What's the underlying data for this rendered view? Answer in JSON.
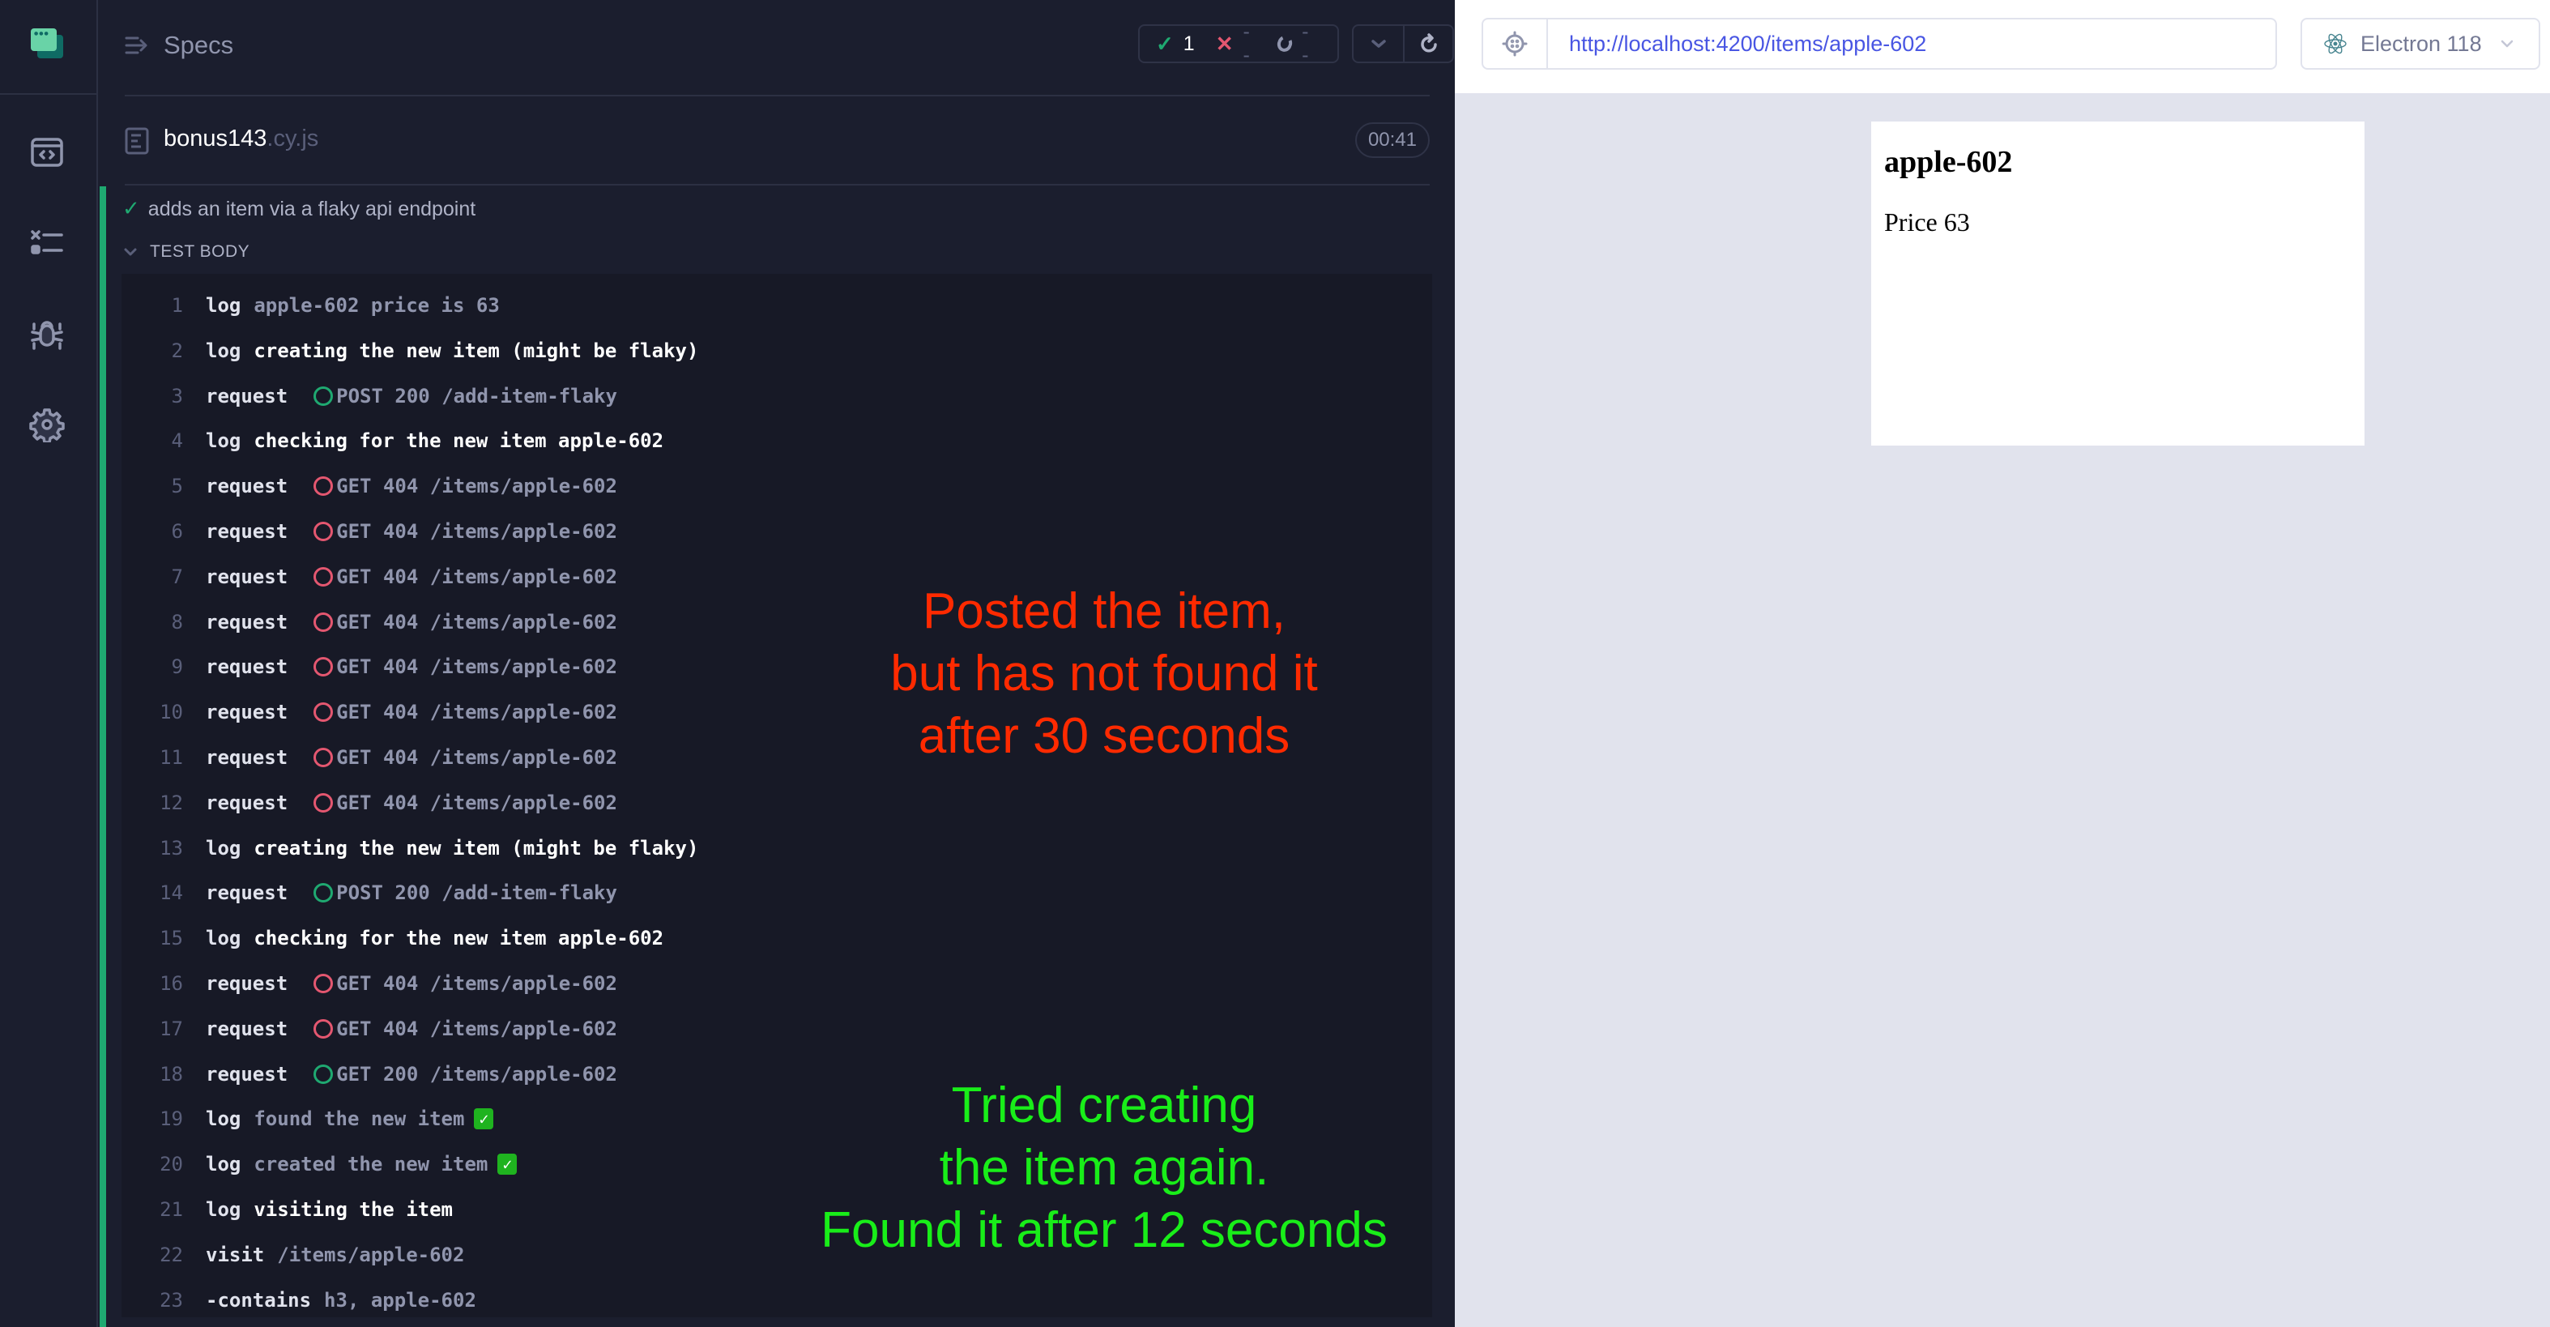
{
  "sidebar": {
    "logo": "cypress-app-logo",
    "items": [
      {
        "name": "specs",
        "icon": "code-window-icon"
      },
      {
        "name": "runs",
        "icon": "test-list-icon"
      },
      {
        "name": "debug",
        "icon": "bug-icon"
      },
      {
        "name": "settings",
        "icon": "gear-icon"
      }
    ]
  },
  "reporter": {
    "header": {
      "title": "Specs",
      "stats": {
        "passed": "1",
        "failed": "--",
        "pending": "--"
      }
    },
    "spec": {
      "name": "bonus143",
      "ext": ".cy.js",
      "duration": "00:41"
    },
    "test": {
      "title": "adds an item via a flaky api endpoint",
      "state": "passed",
      "section": "TEST BODY"
    },
    "commands": [
      {
        "n": "1",
        "cmd": "log",
        "msg": "apple-602 price is 63",
        "strong": false
      },
      {
        "n": "2",
        "cmd": "log",
        "msg": "creating the new item (might be flaky)",
        "strong": true
      },
      {
        "n": "3",
        "cmd": "request",
        "status": "ok",
        "msg": "POST 200 /add-item-flaky"
      },
      {
        "n": "4",
        "cmd": "log",
        "msg": "checking for the new item apple-602",
        "strong": true
      },
      {
        "n": "5",
        "cmd": "request",
        "status": "err",
        "msg": "GET 404 /items/apple-602"
      },
      {
        "n": "6",
        "cmd": "request",
        "status": "err",
        "msg": "GET 404 /items/apple-602"
      },
      {
        "n": "7",
        "cmd": "request",
        "status": "err",
        "msg": "GET 404 /items/apple-602"
      },
      {
        "n": "8",
        "cmd": "request",
        "status": "err",
        "msg": "GET 404 /items/apple-602"
      },
      {
        "n": "9",
        "cmd": "request",
        "status": "err",
        "msg": "GET 404 /items/apple-602"
      },
      {
        "n": "10",
        "cmd": "request",
        "status": "err",
        "msg": "GET 404 /items/apple-602"
      },
      {
        "n": "11",
        "cmd": "request",
        "status": "err",
        "msg": "GET 404 /items/apple-602"
      },
      {
        "n": "12",
        "cmd": "request",
        "status": "err",
        "msg": "GET 404 /items/apple-602"
      },
      {
        "n": "13",
        "cmd": "log",
        "msg": "creating the new item (might be flaky)",
        "strong": true
      },
      {
        "n": "14",
        "cmd": "request",
        "status": "ok",
        "msg": "POST 200 /add-item-flaky"
      },
      {
        "n": "15",
        "cmd": "log",
        "msg": "checking for the new item apple-602",
        "strong": true
      },
      {
        "n": "16",
        "cmd": "request",
        "status": "err",
        "msg": "GET 404 /items/apple-602"
      },
      {
        "n": "17",
        "cmd": "request",
        "status": "err",
        "msg": "GET 404 /items/apple-602"
      },
      {
        "n": "18",
        "cmd": "request",
        "status": "ok",
        "msg": "GET 200 /items/apple-602"
      },
      {
        "n": "19",
        "cmd": "log",
        "msg": "found the new item",
        "strong": false,
        "emoji": "✓"
      },
      {
        "n": "20",
        "cmd": "log",
        "msg": "created the new item",
        "strong": false,
        "emoji": "✓"
      },
      {
        "n": "21",
        "cmd": "log",
        "msg": "visiting the item",
        "strong": true
      },
      {
        "n": "22",
        "cmd": "visit",
        "msg": "/items/apple-602",
        "strong": false
      },
      {
        "n": "23",
        "cmd": "-contains",
        "msg": "h3, apple-602",
        "strong": false
      }
    ],
    "annotations": {
      "red": [
        "Posted the item,",
        "but has not found it",
        "after 30 seconds"
      ],
      "green": [
        "Tried creating",
        "the item again.",
        "Found it after 12 seconds"
      ]
    }
  },
  "preview": {
    "url": "http://localhost:4200/items/apple-602",
    "browser": "Electron 118",
    "aut": {
      "heading": "apple-602",
      "price": "Price 63"
    }
  },
  "colors": {
    "pass": "#1fa971",
    "fail": "#e45770",
    "url": "#4956e3",
    "annotation_red": "#ff2a00",
    "annotation_green": "#19ee19"
  }
}
